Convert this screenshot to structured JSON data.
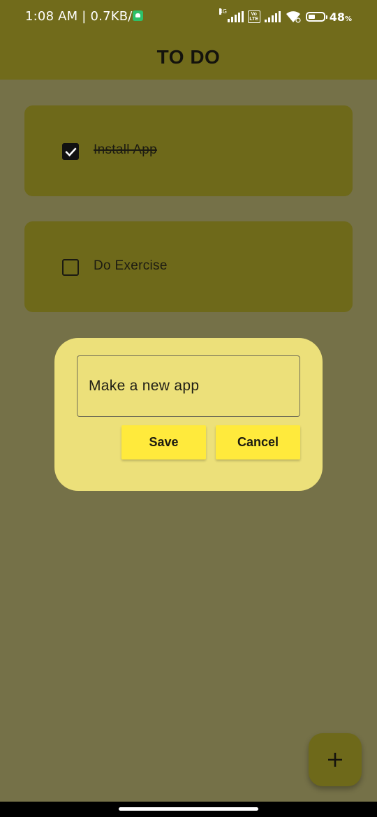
{
  "status_bar": {
    "time": "1:08 AM | 0.7KB/s",
    "network_label": "4G",
    "volte_label": "Vo LTE",
    "battery_percent_number": "48",
    "battery_percent_sign": "%",
    "battery_level": 0.48,
    "icons": [
      "app-notification-icon",
      "signal-icon",
      "volte-icon",
      "signal-icon",
      "wifi-icon",
      "battery-icon"
    ]
  },
  "app_bar": {
    "title": "TO DO"
  },
  "tasks": [
    {
      "label": "Install App",
      "done": true
    },
    {
      "label": "Do Exercise",
      "done": false
    }
  ],
  "dialog": {
    "input_value": "Make a new app",
    "save_label": "Save",
    "cancel_label": "Cancel"
  },
  "fab": {
    "icon": "plus-icon"
  },
  "colors": {
    "app_bar": "#716b1b",
    "background_dimmed": "#757148",
    "task_card": "#6e691a",
    "dialog": "#ece07a",
    "button": "#ffea3c",
    "fab": "#6e691a"
  }
}
